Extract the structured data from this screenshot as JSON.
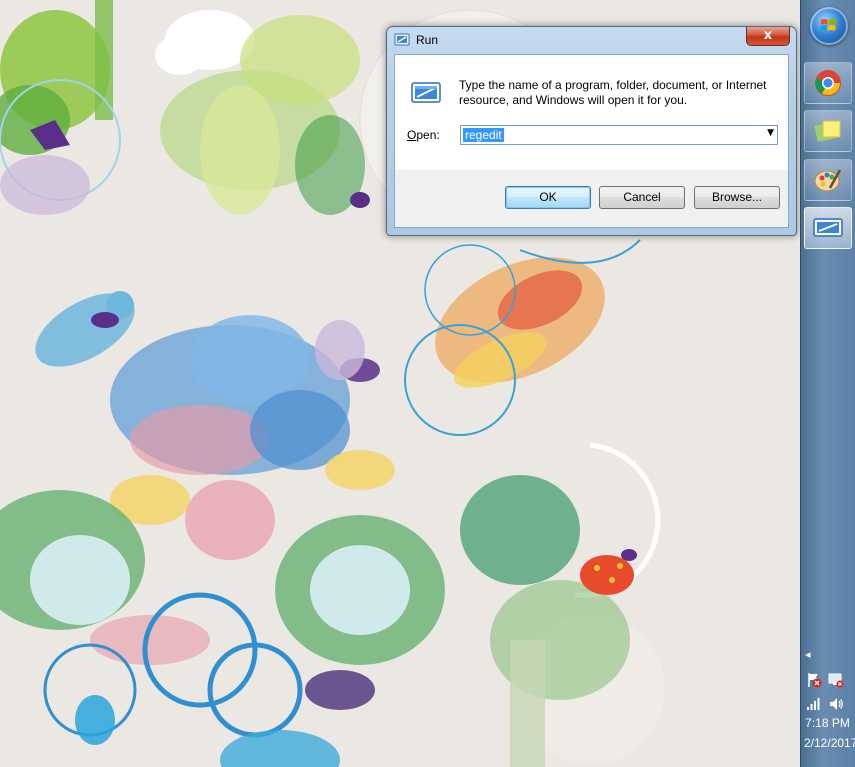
{
  "run_dialog": {
    "title": "Run",
    "close_glyph": "x",
    "description": "Type the name of a program, folder, document, or Internet resource, and Windows will open it for you.",
    "open_label_access": "O",
    "open_label_rest": "pen:",
    "open_value": "regedit",
    "buttons": {
      "ok": "OK",
      "cancel": "Cancel",
      "browse": "Browse..."
    }
  },
  "taskbar": {
    "pinned": [
      {
        "name": "chrome",
        "icon": "chrome-icon"
      },
      {
        "name": "sticky-notes",
        "icon": "sticky-notes-icon"
      },
      {
        "name": "paint",
        "icon": "paint-icon"
      },
      {
        "name": "run",
        "icon": "run-icon",
        "active": true
      }
    ],
    "clock_time": "7:18 PM",
    "clock_date": "2/12/2017"
  },
  "colors": {
    "taskbar": "#5c80a6",
    "title_bar": "#b8cfe6",
    "close_button": "#c03416",
    "selection": "#3399ff"
  }
}
